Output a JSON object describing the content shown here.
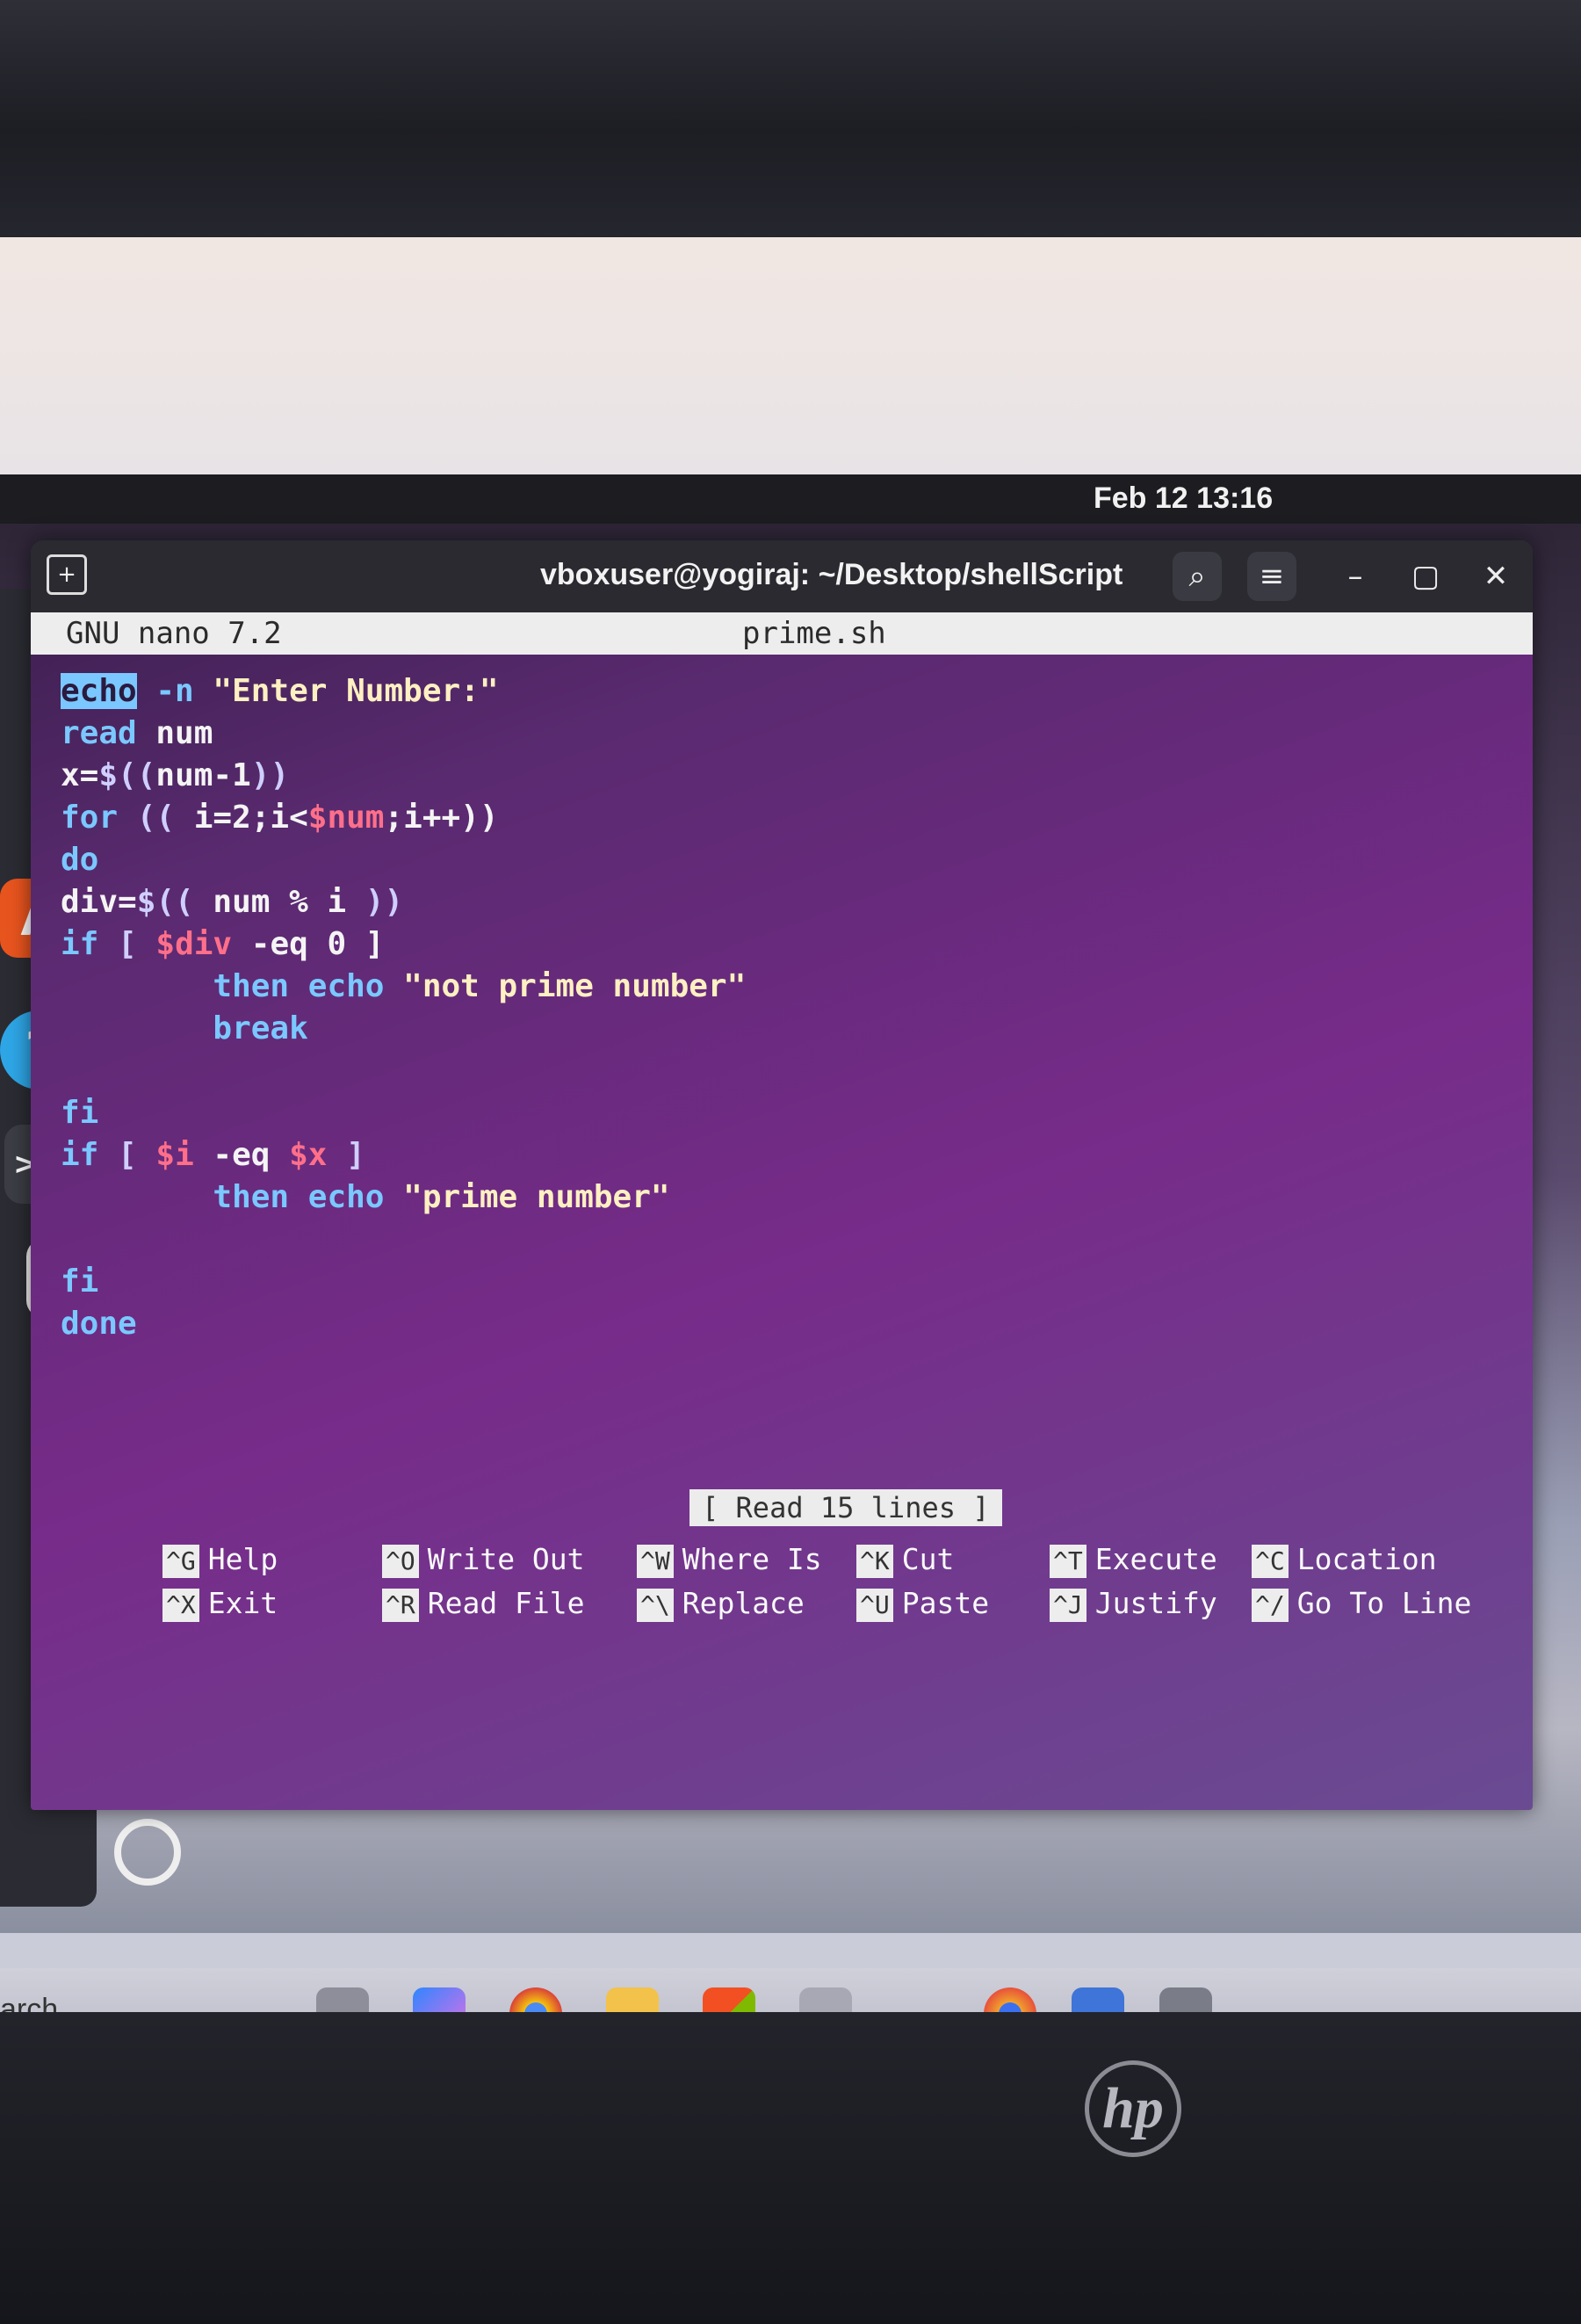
{
  "topbar": {
    "clock": "Feb 12  13:16"
  },
  "terminal": {
    "title": "vboxuser@yogiraj: ~/Desktop/shellScript",
    "icons": [
      "new-tab-icon",
      "search-icon",
      "hamburger-menu-icon",
      "minimize-icon",
      "maximize-icon",
      "close-icon"
    ]
  },
  "nano": {
    "version": "GNU nano 7.2",
    "filename": "prime.sh",
    "status": "[ Read 15 lines ]",
    "code": {
      "l1": {
        "a": "echo",
        "b": " -n ",
        "c": "\"Enter Number:\""
      },
      "l2": {
        "a": "read",
        "b": " num"
      },
      "l3": {
        "a": "x=",
        "b": "$((",
        "c": "num-1",
        "d": "))"
      },
      "l4": {
        "a": "for",
        "b": " (( ",
        "c": "i=2;i<",
        "d": "$num",
        "e": ";i++))"
      },
      "l5": {
        "a": "do"
      },
      "l6": {
        "a": "div=",
        "b": "$(( ",
        "c": "num % i ",
        "d": "))"
      },
      "l7": {
        "a": "if",
        "b": " [ ",
        "c": "$div",
        "d": " -eq 0 ]"
      },
      "l8": {
        "a": "        then ",
        "b": "echo",
        "c": " \"not prime number\""
      },
      "l9": {
        "a": "        break"
      },
      "l10": {
        "a": ""
      },
      "l11": {
        "a": "fi"
      },
      "l12": {
        "a": "if",
        "b": " [ ",
        "c": "$i",
        "d": " -eq ",
        "e": "$x",
        "f": " ]"
      },
      "l13": {
        "a": "        then ",
        "b": "echo",
        "c": " \"prime number\""
      },
      "l14": {
        "a": ""
      },
      "l15": {
        "a": "fi"
      },
      "l16": {
        "a": "done"
      }
    },
    "shortcuts": [
      {
        "key": "^G",
        "label": "Help"
      },
      {
        "key": "^X",
        "label": "Exit"
      },
      {
        "key": "^O",
        "label": "Write Out"
      },
      {
        "key": "^R",
        "label": "Read File"
      },
      {
        "key": "^W",
        "label": "Where Is"
      },
      {
        "key": "^\\",
        "label": "Replace"
      },
      {
        "key": "^K",
        "label": "Cut"
      },
      {
        "key": "^U",
        "label": "Paste"
      },
      {
        "key": "^T",
        "label": "Execute"
      },
      {
        "key": "^J",
        "label": "Justify"
      },
      {
        "key": "^C",
        "label": "Location"
      },
      {
        "key": "^/",
        "label": "Go To Line"
      }
    ]
  },
  "host": {
    "search_fragment": "arch",
    "taskbar_icons": [
      "task-view-icon",
      "copilot-icon",
      "chrome-icon",
      "file-explorer-icon",
      "store-icon",
      "text-app-icon",
      "chrome-canary-icon",
      "virtualbox-icon",
      "tools-icon"
    ],
    "brand": "hp"
  },
  "colors": {
    "terminal_bg": "#772b8a",
    "keyword": "#7ac8ff",
    "variable": "#ff6f8a",
    "string": "#fff0c2",
    "nano_bar": "#ededed"
  }
}
